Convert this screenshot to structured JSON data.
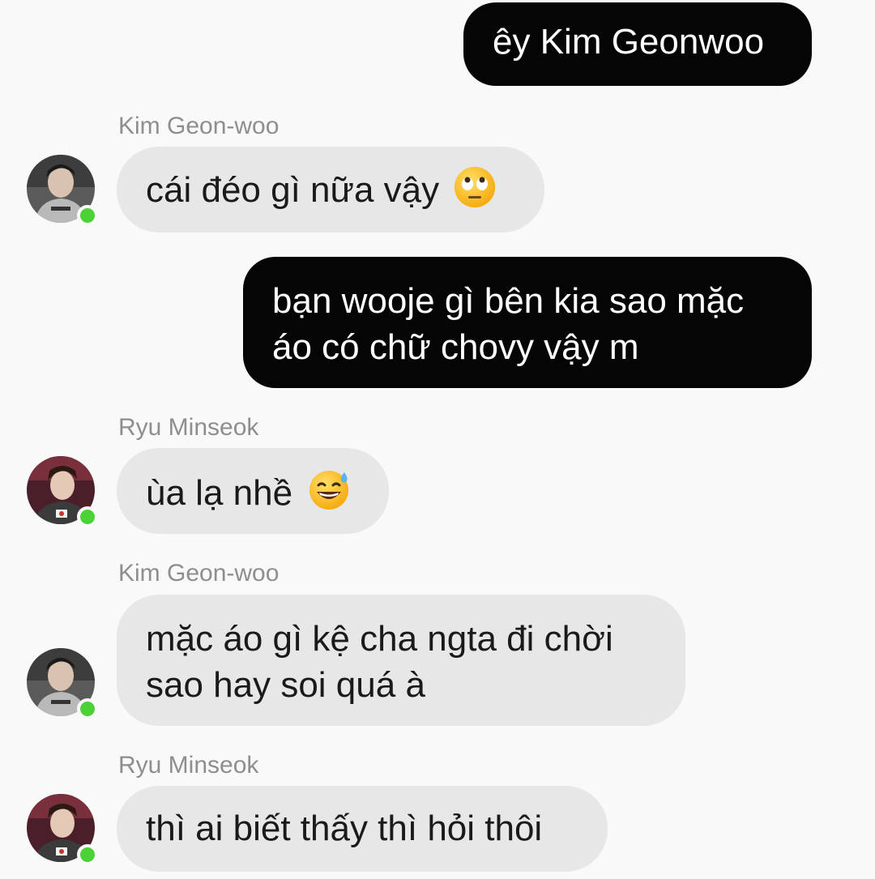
{
  "messages": [
    {
      "type": "outgoing",
      "text": "êy Kim Geonwoo"
    },
    {
      "type": "incoming",
      "sender": "Kim Geon-woo",
      "text": "cái đéo gì nữa vậy",
      "emoji": "eye-roll-emoji"
    },
    {
      "type": "outgoing",
      "lines": [
        "bạn wooje gì bên kia sao mặc",
        "áo có chữ chovy vậy m"
      ]
    },
    {
      "type": "incoming",
      "sender": "Ryu Minseok",
      "text": "ùa lạ nhề",
      "emoji": "sweat-smile-emoji"
    },
    {
      "type": "incoming",
      "sender": "Kim Geon-woo",
      "lines": [
        "mặc áo gì kệ cha ngta đi chời",
        "sao hay soi quá à"
      ]
    },
    {
      "type": "incoming",
      "sender": "Ryu Minseok",
      "text": "thì ai biết thấy thì hỏi thôi"
    }
  ],
  "colors": {
    "outgoing_bg": "#050505",
    "incoming_bg": "#e7e7e7",
    "online": "#4cd137",
    "sender_text": "#8e8e8e"
  }
}
